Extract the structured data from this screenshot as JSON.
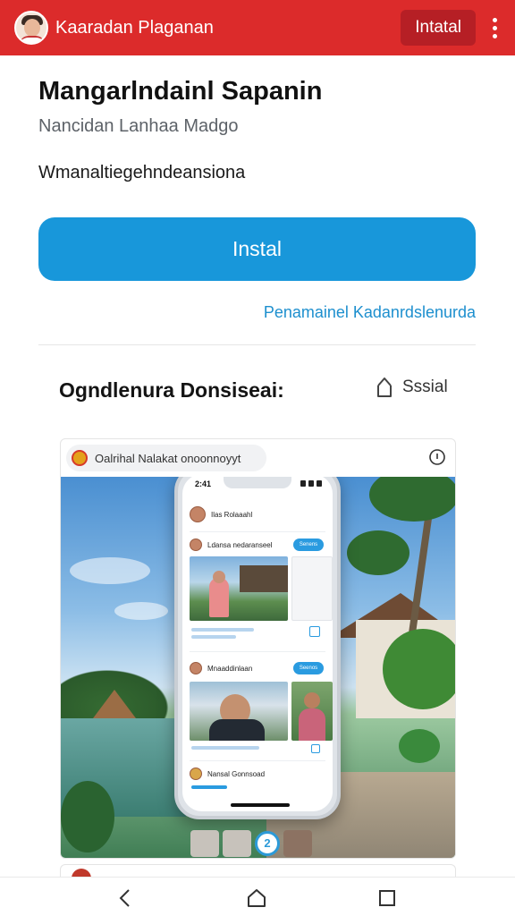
{
  "app_bar": {
    "title": "Kaaradan Plaganan",
    "install_label": "Intatal",
    "background": "#dc2b2b"
  },
  "header": {
    "title": "Mangarlndainl Sapanin",
    "subtitle": "Nancidan Lanhaa Madgo",
    "description": "Wmanaltiegehndeansiona"
  },
  "install_button": {
    "label": "Instal",
    "color": "#1897da"
  },
  "link": {
    "label": "Penamainel Kadanrdslenurda",
    "color": "#1d8fce"
  },
  "section": {
    "title": "Ogndlenura Donsiseai:",
    "share_label": "Sssial",
    "share_icon": "share-icon"
  },
  "card": {
    "chip_text": "Oalrihal Nalakat onoonnoyyt",
    "info_icon": "info-icon",
    "phone": {
      "time": "2:41",
      "profile_name": "Ilas Rolaaahl",
      "post1_name": "Ldansa nedaranseel",
      "post1_action": "Senens",
      "post2_name": "Mnaaddinlaan",
      "post2_action": "Seenos",
      "post3_name": "Nansal Gonnsoad"
    },
    "strip_counter": "2"
  },
  "nav": {
    "back_icon": "back-icon",
    "home_icon": "home-icon",
    "recents_icon": "recents-icon"
  }
}
